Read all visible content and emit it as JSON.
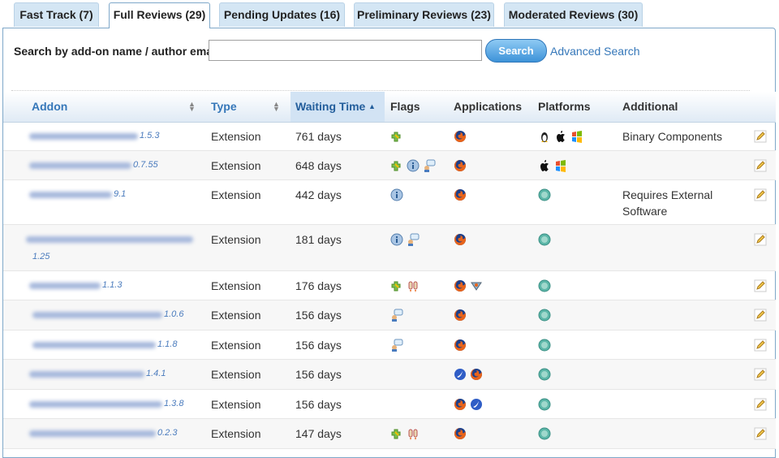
{
  "tabs": [
    {
      "label": "Fast Track (7)"
    },
    {
      "label": "Full Reviews (29)",
      "active": true
    },
    {
      "label": "Pending Updates (16)"
    },
    {
      "label": "Preliminary Reviews (23)"
    },
    {
      "label": "Moderated Reviews (30)"
    }
  ],
  "search": {
    "label": "Search by add-on name / author email",
    "placeholder": "",
    "value": "",
    "button": "Search",
    "advanced": "Advanced Search"
  },
  "table": {
    "columns": [
      "Addon",
      "Type",
      "Waiting Time",
      "Flags",
      "Applications",
      "Platforms",
      "Additional"
    ],
    "rows": [
      {
        "version": "1.5.3",
        "type": "Extension",
        "waiting": "761 days",
        "flags": [
          "addon-icon"
        ],
        "apps": [
          "firefox-icon"
        ],
        "platforms": [
          "linux-icon",
          "apple-icon",
          "windows-icon"
        ],
        "additional": "Binary Components"
      },
      {
        "version": "0.7.55",
        "type": "Extension",
        "waiting": "648 days",
        "flags": [
          "addon-icon",
          "info-icon",
          "comment-icon"
        ],
        "apps": [
          "firefox-icon"
        ],
        "platforms": [
          "apple-icon",
          "windows-icon"
        ],
        "additional": ""
      },
      {
        "version": "9.1",
        "type": "Extension",
        "waiting": "442 days",
        "flags": [
          "info-icon"
        ],
        "apps": [
          "firefox-icon"
        ],
        "platforms": [
          "globe-icon"
        ],
        "additional": "Requires External Software"
      },
      {
        "version": "1.25",
        "type": "Extension",
        "waiting": "181 days",
        "flags": [
          "info-icon",
          "comment-icon"
        ],
        "apps": [
          "firefox-icon"
        ],
        "platforms": [
          "globe-icon"
        ],
        "additional": ""
      },
      {
        "version": "1.1.3",
        "type": "Extension",
        "waiting": "176 days",
        "flags": [
          "addon-icon",
          "jetpack-icon"
        ],
        "apps": [
          "firefox-icon",
          "mobile-icon"
        ],
        "platforms": [
          "globe-icon"
        ],
        "additional": ""
      },
      {
        "version": "1.0.6",
        "type": "Extension",
        "waiting": "156 days",
        "flags": [
          "comment-icon"
        ],
        "apps": [
          "firefox-icon"
        ],
        "platforms": [
          "globe-icon"
        ],
        "additional": ""
      },
      {
        "version": "1.1.8",
        "type": "Extension",
        "waiting": "156 days",
        "flags": [
          "comment-icon"
        ],
        "apps": [
          "firefox-icon"
        ],
        "platforms": [
          "globe-icon"
        ],
        "additional": ""
      },
      {
        "version": "1.4.1",
        "type": "Extension",
        "waiting": "156 days",
        "flags": [],
        "apps": [
          "thunderbird-icon",
          "firefox-icon"
        ],
        "platforms": [
          "globe-icon"
        ],
        "additional": ""
      },
      {
        "version": "1.3.8",
        "type": "Extension",
        "waiting": "156 days",
        "flags": [],
        "apps": [
          "firefox-icon",
          "thunderbird-icon"
        ],
        "platforms": [
          "globe-icon"
        ],
        "additional": ""
      },
      {
        "version": "0.2.3",
        "type": "Extension",
        "waiting": "147 days",
        "flags": [
          "addon-icon",
          "jetpack-icon"
        ],
        "apps": [
          "firefox-icon"
        ],
        "platforms": [
          "globe-icon"
        ],
        "additional": ""
      }
    ]
  }
}
